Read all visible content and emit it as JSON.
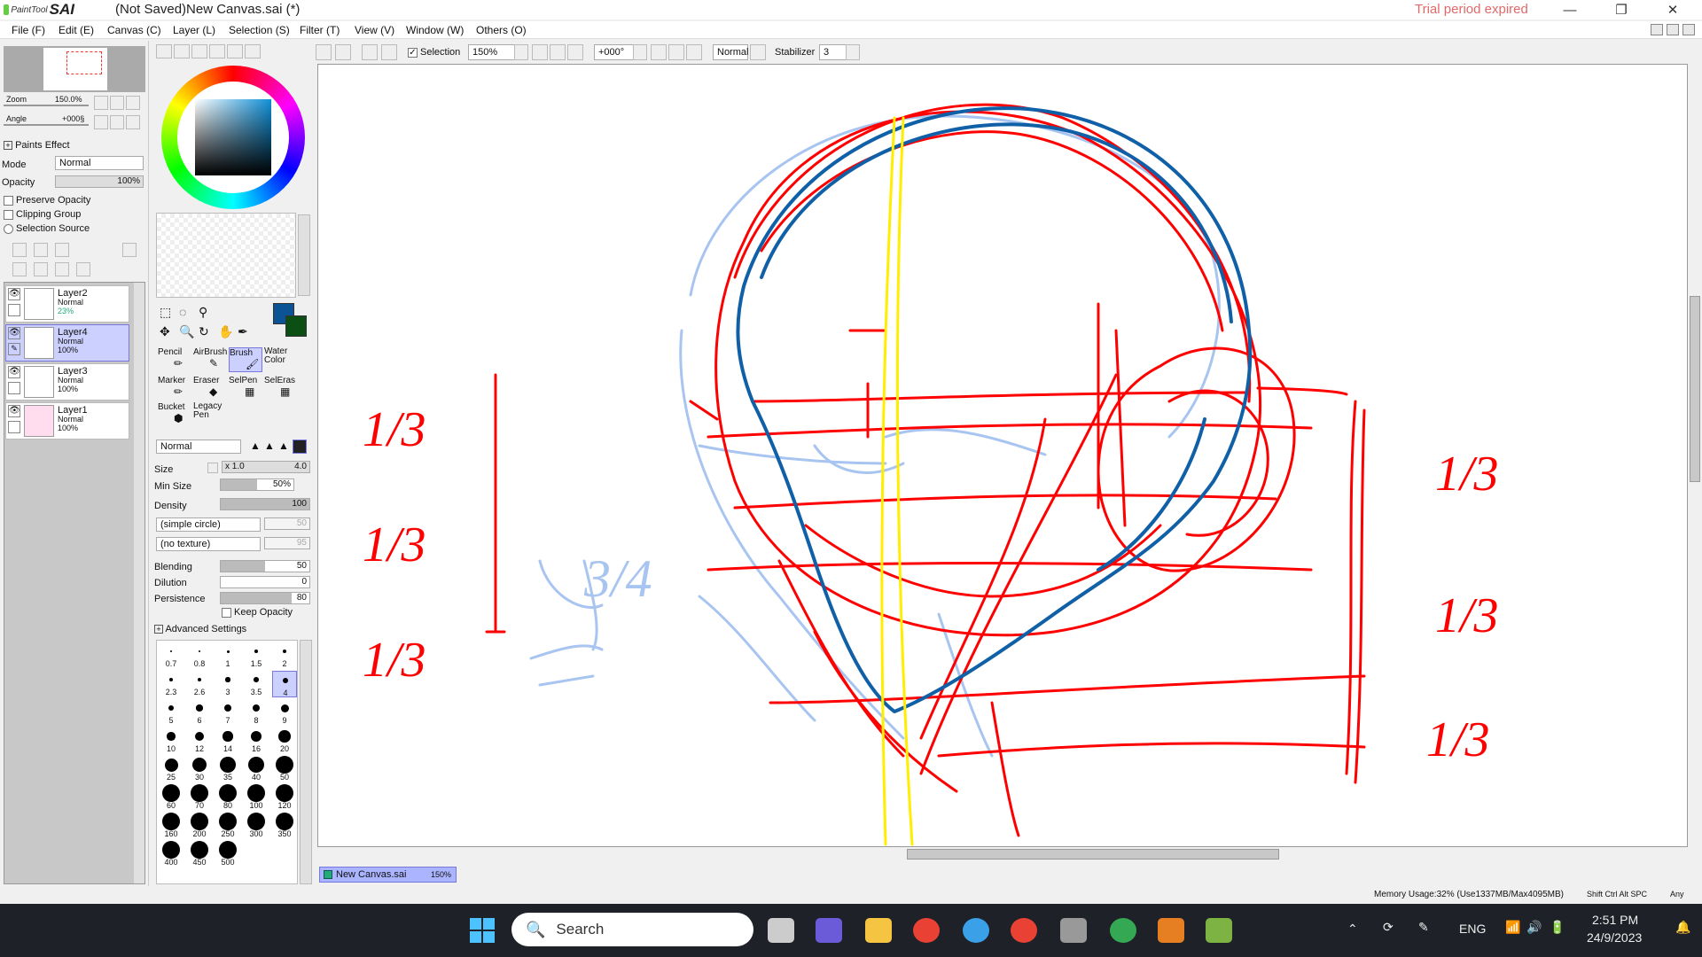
{
  "titlebar": {
    "logo_small": "PaintTool",
    "logo_big": "SAI",
    "title": "(Not Saved)New Canvas.sai (*)",
    "trial": "Trial period expired",
    "minimize": "—",
    "restore": "❐",
    "close": "✕"
  },
  "menu": [
    "File (F)",
    "Edit (E)",
    "Canvas (C)",
    "Layer (L)",
    "Selection (S)",
    "Filter (T)",
    "View (V)",
    "Window (W)",
    "Others (O)"
  ],
  "toolbar": {
    "selection_label": "Selection",
    "zoom_value": "150%",
    "angle_value": "+000°",
    "blend_mode": "Normal",
    "stabilizer_label": "Stabilizer",
    "stabilizer_value": "3"
  },
  "navigator": {
    "zoom_label": "Zoom",
    "zoom_value": "150.0%",
    "angle_label": "Angle",
    "angle_value": "+000§"
  },
  "layer_props": {
    "paints_effect": "Paints Effect",
    "mode_label": "Mode",
    "mode_value": "Normal",
    "opacity_label": "Opacity",
    "opacity_value": "100%",
    "preserve_opacity": "Preserve Opacity",
    "clipping_group": "Clipping Group",
    "selection_source": "Selection Source"
  },
  "layers": [
    {
      "name": "Layer2",
      "mode": "Normal",
      "opacity": "23%",
      "selected": false
    },
    {
      "name": "Layer4",
      "mode": "Normal",
      "opacity": "100%",
      "selected": true
    },
    {
      "name": "Layer3",
      "mode": "Normal",
      "opacity": "100%",
      "selected": false
    },
    {
      "name": "Layer1",
      "mode": "Normal",
      "opacity": "100%",
      "selected": false
    }
  ],
  "colors": {
    "primary": "#0b5394",
    "secondary": "#0b4f14",
    "red_stroke": "#ff0000",
    "blue_stroke": "#1060a8",
    "yellow_stroke": "#ffee00",
    "light_blue_stroke": "#a8c4f0"
  },
  "tools": {
    "pencil": "Pencil",
    "airbrush": "AirBrush",
    "brush": "Brush",
    "water": "Water",
    "color": "Color",
    "marker": "Marker",
    "eraser": "Eraser",
    "selpen": "SelPen",
    "seleras": "SelEras",
    "bucket": "Bucket",
    "legacy": "Legacy",
    "pen": "Pen"
  },
  "brush": {
    "mode": "Normal",
    "size_label": "Size",
    "size_mult": "x 1.0",
    "size_value": "4.0",
    "minsize_label": "Min Size",
    "minsize_value": "50%",
    "density_label": "Density",
    "density_value": "100",
    "shape": "(simple circle)",
    "shape_value": "50",
    "texture": "(no texture)",
    "texture_value": "95",
    "blending_label": "Blending",
    "blending_value": "50",
    "dilution_label": "Dilution",
    "dilution_value": "0",
    "persistence_label": "Persistence",
    "persistence_value": "80",
    "keep_opacity": "Keep Opacity",
    "advanced": "Advanced Settings"
  },
  "brush_sizes": [
    "0.7",
    "0.8",
    "1",
    "1.5",
    "2",
    "2.3",
    "2.6",
    "3",
    "3.5",
    "4",
    "5",
    "6",
    "7",
    "8",
    "9",
    "10",
    "12",
    "14",
    "16",
    "20",
    "25",
    "30",
    "35",
    "40",
    "50",
    "60",
    "70",
    "80",
    "100",
    "120",
    "160",
    "200",
    "250",
    "300",
    "350",
    "400",
    "450",
    "500"
  ],
  "canvas_annotations": {
    "left_top": "1/3",
    "left_mid": "1/3",
    "left_bot": "1/3",
    "right_top": "1/3",
    "right_mid": "1/3",
    "right_bot": "1/3",
    "sketch_34": "3/4"
  },
  "document": {
    "tab_name": "New Canvas.sai",
    "tab_zoom": "150%"
  },
  "status": {
    "memory": "Memory Usage:32% (Use1337MB/Max4095MB)",
    "keys": "Shift Ctrl Alt SPC",
    "any": "Any"
  },
  "taskbar": {
    "search_placeholder": "Search",
    "lang": "ENG",
    "time": "2:51 PM",
    "date": "24/9/2023"
  }
}
